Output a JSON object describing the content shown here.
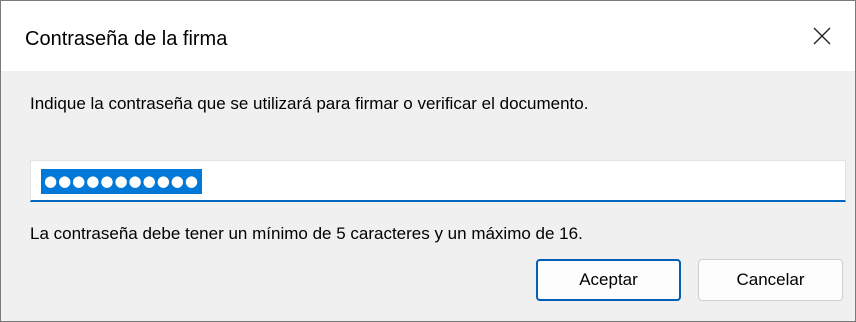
{
  "dialog": {
    "title": "Contraseña de la firma",
    "close_icon": "close-icon",
    "prompt": "Indique la contraseña que se utilizará para firmar o verificar el documento.",
    "password_masked": "●●●●●●●●●●●",
    "note": "La contraseña debe tener un mínimo de 5 caracteres y un máximo de 16.",
    "ok_label": "Aceptar",
    "cancel_label": "Cancelar"
  },
  "colors": {
    "accent": "#0067c0",
    "selection": "#0078d7",
    "dialog_background": "#f0f0f0"
  }
}
